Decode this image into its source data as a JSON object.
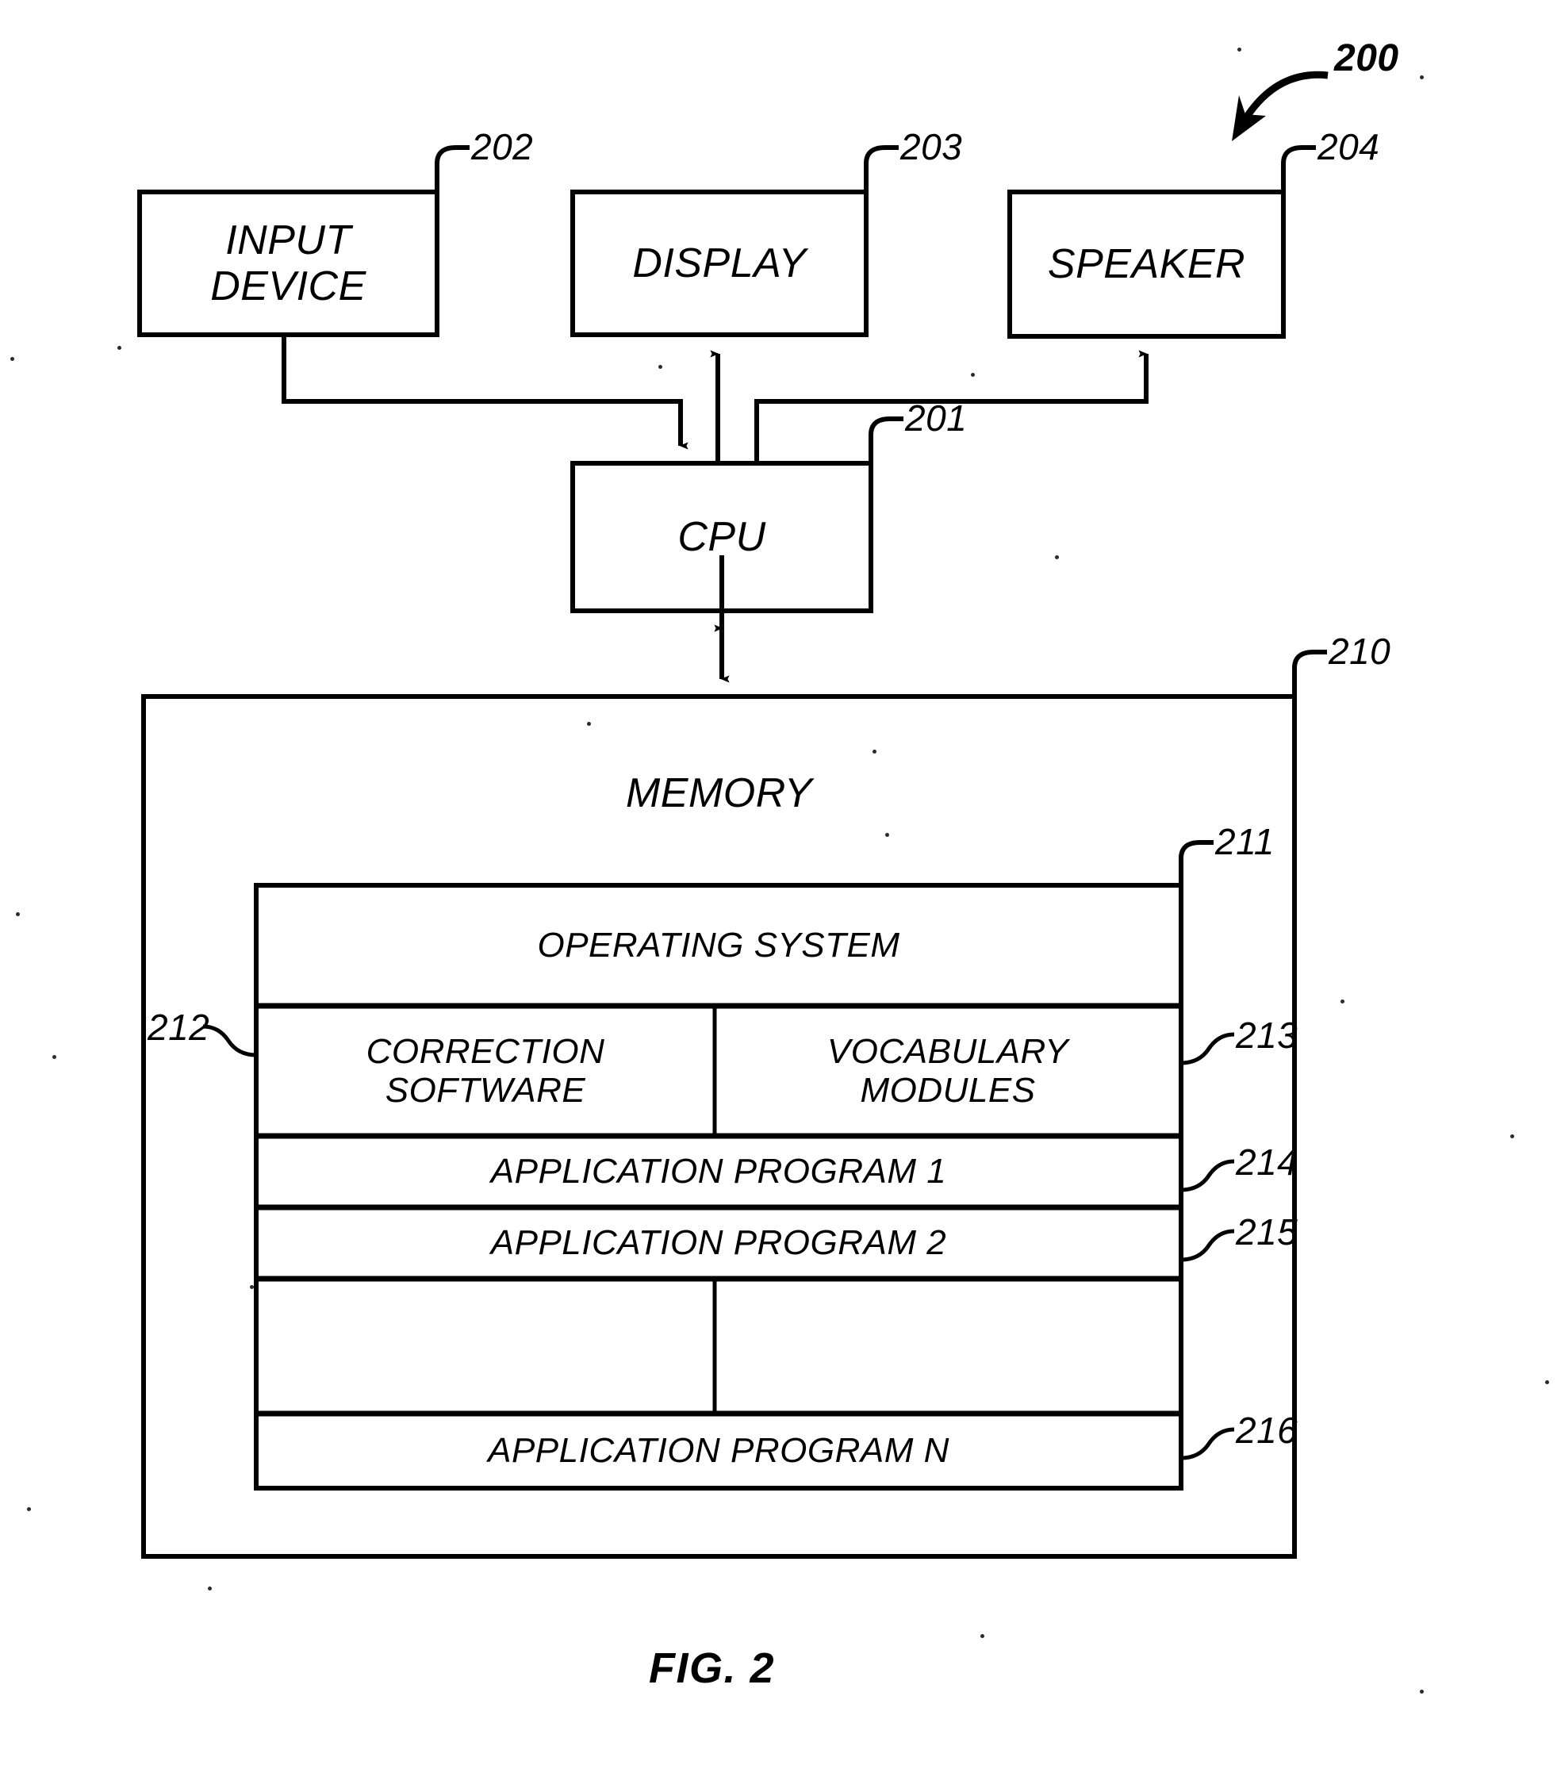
{
  "figure": {
    "caption": "FIG. 2",
    "system_ref": "200"
  },
  "nodes": {
    "input_device": {
      "label": "INPUT\nDEVICE",
      "ref": "202"
    },
    "display": {
      "label": "DISPLAY",
      "ref": "203"
    },
    "speaker": {
      "label": "SPEAKER",
      "ref": "204"
    },
    "cpu": {
      "label": "CPU",
      "ref": "201"
    },
    "memory": {
      "label": "MEMORY",
      "ref": "210"
    }
  },
  "memory_table": {
    "rows": [
      {
        "cells": [
          {
            "label": "OPERATING SYSTEM",
            "ref": "211"
          }
        ]
      },
      {
        "cells": [
          {
            "label": "CORRECTION\nSOFTWARE",
            "ref": "212"
          },
          {
            "label": "VOCABULARY\nMODULES",
            "ref": "213"
          }
        ]
      },
      {
        "cells": [
          {
            "label": "APPLICATION PROGRAM 1",
            "ref": "214"
          }
        ]
      },
      {
        "cells": [
          {
            "label": "APPLICATION PROGRAM 2",
            "ref": "215"
          }
        ]
      },
      {
        "cells": [
          {
            "label": "",
            "ref": ""
          },
          {
            "label": "",
            "ref": ""
          }
        ]
      },
      {
        "cells": [
          {
            "label": "APPLICATION PROGRAM N",
            "ref": "216"
          }
        ]
      }
    ]
  },
  "colors": {
    "ink": "#000000",
    "paper": "#ffffff"
  }
}
